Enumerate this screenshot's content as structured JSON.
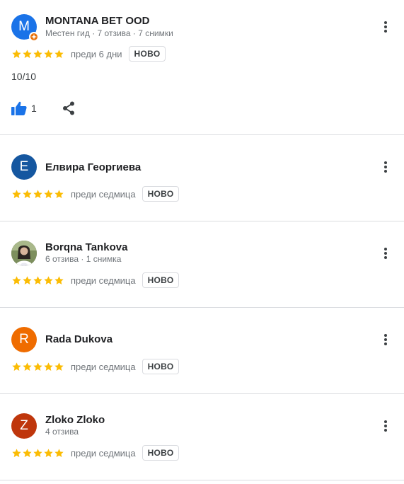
{
  "reviews": [
    {
      "initial": "M",
      "avatar_color": "#1a73e8",
      "name": "MONTANA BET OOD",
      "meta": "Местен гид · 7 отзива · 7 снимки",
      "local_guide": true,
      "stars": 5,
      "when": "преди 6 дни",
      "badge": "НОВО",
      "text": "10/10",
      "likes": "1"
    },
    {
      "initial": "Е",
      "avatar_color": "#1557a0",
      "name": "Елвира Георгиева",
      "meta": "",
      "stars": 5,
      "when": "преди седмица",
      "badge": "НОВО"
    },
    {
      "initial": "",
      "avatar_type": "photo",
      "name": "Borqna Tankova",
      "meta": "6 отзива · 1 снимка",
      "stars": 5,
      "when": "преди седмица",
      "badge": "НОВО"
    },
    {
      "initial": "R",
      "avatar_color": "#ef6c00",
      "name": "Rada Dukova",
      "meta": "",
      "stars": 5,
      "when": "преди седмица",
      "badge": "НОВО"
    },
    {
      "initial": "Z",
      "avatar_color": "#bf360c",
      "name": "Zloko Zloko",
      "meta": "4 отзива",
      "stars": 5,
      "when": "преди седмица",
      "badge": "НОВО"
    }
  ],
  "colors": {
    "star": "#fbbc04",
    "like": "#1a73e8",
    "divider": "#dadce0"
  }
}
